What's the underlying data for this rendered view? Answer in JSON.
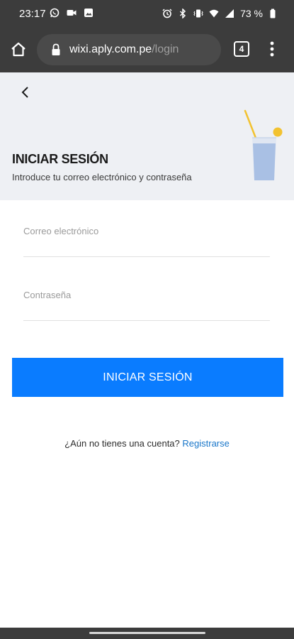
{
  "status_bar": {
    "time": "23:17",
    "battery_percent": "73 %",
    "left_icons": [
      "whatsapp-icon",
      "video-icon",
      "gallery-icon"
    ],
    "right_icons": [
      "alarm-icon",
      "bluetooth-icon",
      "vibrate-icon",
      "wifi-icon",
      "signal-icon",
      "battery-icon"
    ]
  },
  "browser": {
    "url_host": "wixi.aply.com.pe",
    "url_path": "/login",
    "tab_count": "4"
  },
  "header": {
    "title": "INICIAR SESIÓN",
    "subtitle": "Introduce tu correo electrónico y contraseña"
  },
  "form": {
    "email_placeholder": "Correo electrónico",
    "email_value": "",
    "password_placeholder": "Contraseña",
    "password_value": "",
    "submit_label": "INICIAR SESIÓN"
  },
  "signup": {
    "prompt": "¿Aún no tienes una cuenta?",
    "link_label": "Registrarse"
  },
  "colors": {
    "primary": "#0a7cff",
    "link": "#1876c9",
    "header_bg": "#eef0f4",
    "system_bar": "#3c3c3c"
  }
}
